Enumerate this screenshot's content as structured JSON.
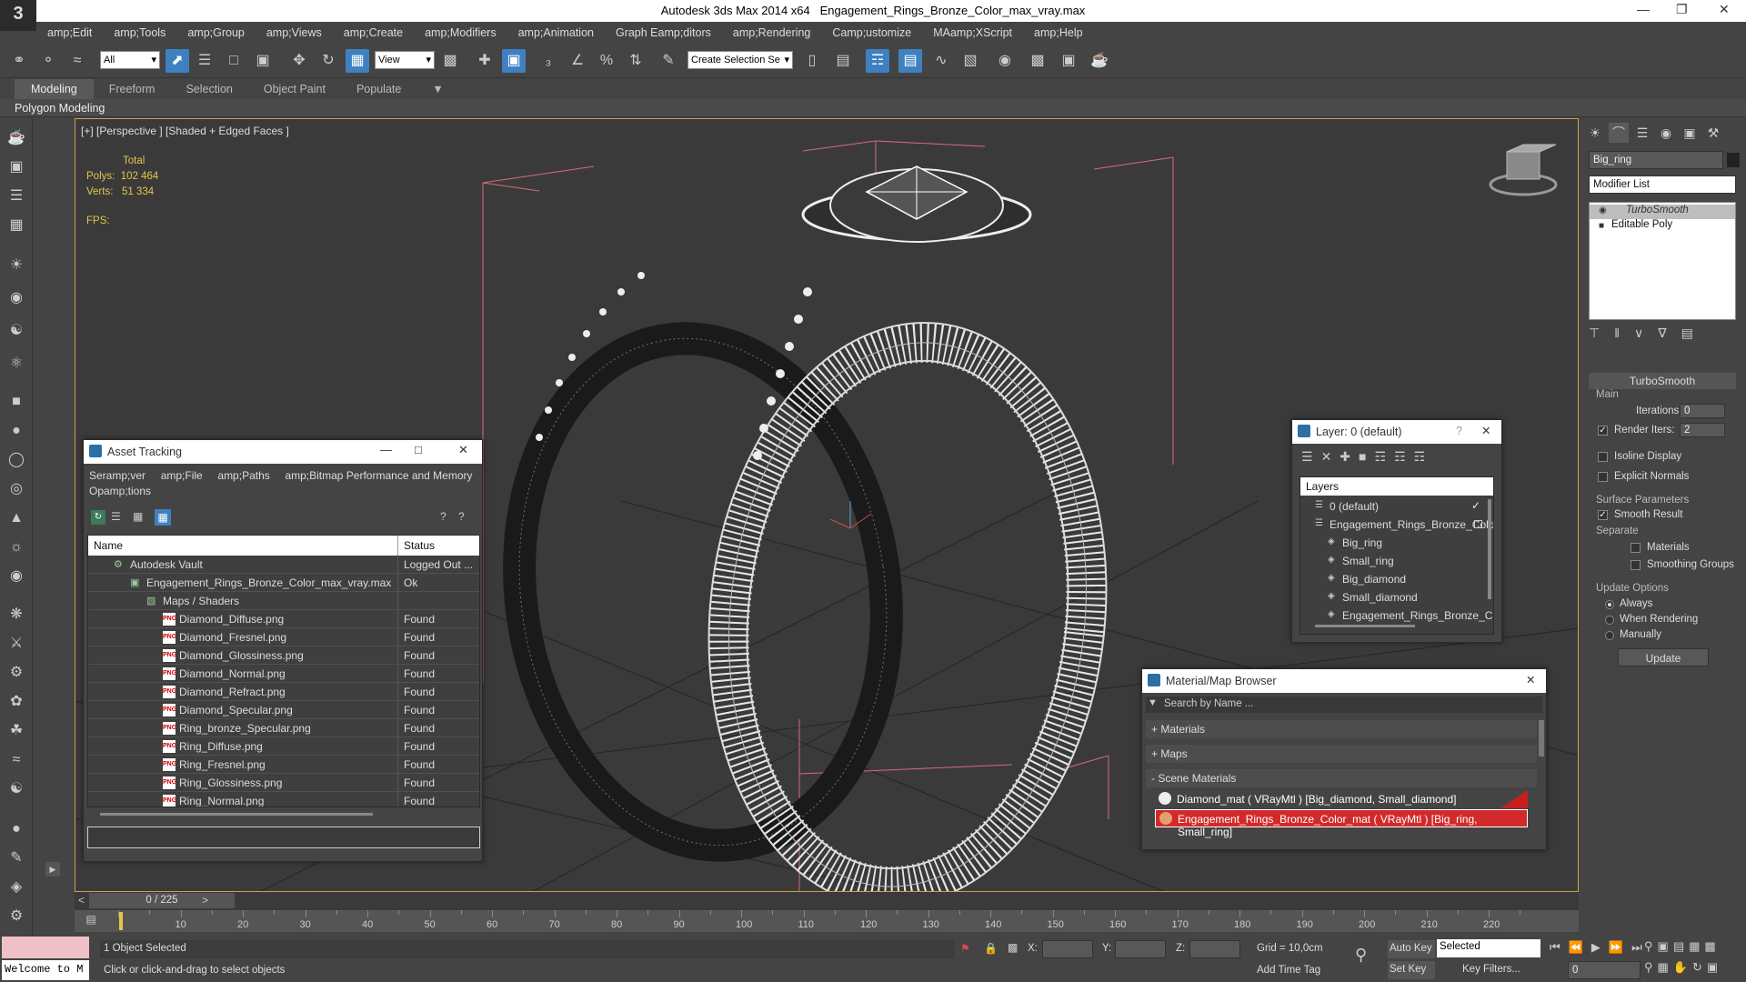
{
  "title": {
    "app": "Autodesk 3ds Max  2014 x64",
    "file": "Engagement_Rings_Bronze_Color_max_vray.max",
    "logo": "3"
  },
  "menu": [
    "amp;Edit",
    "amp;Tools",
    "amp;Group",
    "amp;Views",
    "amp;Create",
    "amp;Modifiers",
    "amp;Animation",
    "Graph Eamp;ditors",
    "amp;Rendering",
    "Camp;ustomize",
    "MAamp;XScript",
    "amp;Help"
  ],
  "toolbar": {
    "filter": "All",
    "refcoord": "View",
    "named_sel": "Create Selection Se"
  },
  "ribbon": {
    "tabs": [
      "Modeling",
      "Freeform",
      "Selection",
      "Object Paint",
      "Populate"
    ],
    "sub": "Polygon Modeling"
  },
  "viewport": {
    "label": "[+] [Perspective ] [Shaded + Edged Faces ]",
    "stats_total": "Total",
    "polys_label": "Polys:",
    "polys": "102 464",
    "verts_label": "Verts:",
    "verts": "51 334",
    "fps_label": "FPS:"
  },
  "command_panel": {
    "object_name": "Big_ring",
    "modifier_list": "Modifier List",
    "stack": [
      "TurboSmooth",
      "Editable Poly"
    ],
    "rollout": "TurboSmooth",
    "main": "Main",
    "iterations_label": "Iterations:",
    "iterations": "0",
    "render_iters_label": "Render Iters:",
    "render_iters": "2",
    "isoline": "Isoline Display",
    "explicit": "Explicit Normals",
    "surface": "Surface Parameters",
    "smooth": "Smooth Result",
    "separate": "Separate",
    "materials": "Materials",
    "smoothing": "Smoothing Groups",
    "update_opts": "Update Options",
    "always": "Always",
    "when_rendering": "When Rendering",
    "manually": "Manually",
    "update": "Update"
  },
  "asset_tracking": {
    "title": "Asset Tracking",
    "menu": [
      "Seramp;ver",
      "amp;File",
      "amp;Paths",
      "amp;Bitmap Performance and Memory"
    ],
    "menu2": "Opamp;tions",
    "col_name": "Name",
    "col_status": "Status",
    "rows": [
      {
        "name": "Autodesk Vault",
        "status": "Logged Out ...",
        "indent": 0
      },
      {
        "name": "Engagement_Rings_Bronze_Color_max_vray.max",
        "status": "Ok",
        "indent": 1
      },
      {
        "name": "Maps / Shaders",
        "status": "",
        "indent": 2
      },
      {
        "name": "Diamond_Diffuse.png",
        "status": "Found",
        "indent": 3
      },
      {
        "name": "Diamond_Fresnel.png",
        "status": "Found",
        "indent": 3
      },
      {
        "name": "Diamond_Glossiness.png",
        "status": "Found",
        "indent": 3
      },
      {
        "name": "Diamond_Normal.png",
        "status": "Found",
        "indent": 3
      },
      {
        "name": "Diamond_Refract.png",
        "status": "Found",
        "indent": 3
      },
      {
        "name": "Diamond_Specular.png",
        "status": "Found",
        "indent": 3
      },
      {
        "name": "Ring_bronze_Specular.png",
        "status": "Found",
        "indent": 3
      },
      {
        "name": "Ring_Diffuse.png",
        "status": "Found",
        "indent": 3
      },
      {
        "name": "Ring_Fresnel.png",
        "status": "Found",
        "indent": 3
      },
      {
        "name": "Ring_Glossiness.png",
        "status": "Found",
        "indent": 3
      },
      {
        "name": "Ring_Normal.png",
        "status": "Found",
        "indent": 3
      }
    ]
  },
  "layers": {
    "title": "Layer: 0 (default)",
    "help": "?",
    "header": "Layers",
    "rows": [
      {
        "name": "0 (default)",
        "indent": 0
      },
      {
        "name": "Engagement_Rings_Bronze_Color",
        "indent": 0
      },
      {
        "name": "Big_ring",
        "indent": 1
      },
      {
        "name": "Small_ring",
        "indent": 1
      },
      {
        "name": "Big_diamond",
        "indent": 1
      },
      {
        "name": "Small_diamond",
        "indent": 1
      },
      {
        "name": "Engagement_Rings_Bronze_Color",
        "indent": 1
      }
    ]
  },
  "material_browser": {
    "title": "Material/Map Browser",
    "search": "Search by Name ...",
    "sections": [
      "+ Materials",
      "+ Maps",
      "- Scene Materials"
    ],
    "items": [
      "Diamond_mat  ( VRayMtl ) [Big_diamond, Small_diamond]",
      "Engagement_Rings_Bronze_Color_mat  ( VRayMtl ) [Big_ring, Small_ring]"
    ]
  },
  "timeline": {
    "frame": "0 / 225",
    "ticks": [
      "10",
      "20",
      "30",
      "40",
      "50",
      "60",
      "70",
      "80",
      "90",
      "100",
      "110",
      "120",
      "130",
      "140",
      "150",
      "160",
      "170",
      "180",
      "190",
      "200",
      "210",
      "220"
    ]
  },
  "status": {
    "welcome": "Welcome to M",
    "selected": "1 Object Selected",
    "hint": "Click or click-and-drag to select objects",
    "x": "X:",
    "y": "Y:",
    "z": "Z:",
    "grid": "Grid = 10,0cm",
    "autokey": "Auto Key",
    "setkey": "Set Key",
    "sel_mode": "Selected",
    "keyfilters": "Key Filters...",
    "addtime": "Add Time Tag",
    "frame_field": "0"
  },
  "colors": {
    "accent": "#3f80c0",
    "viewport_border": "#c9a14a",
    "stats": "#e6c44b",
    "selected_row": "#d22a2a"
  }
}
